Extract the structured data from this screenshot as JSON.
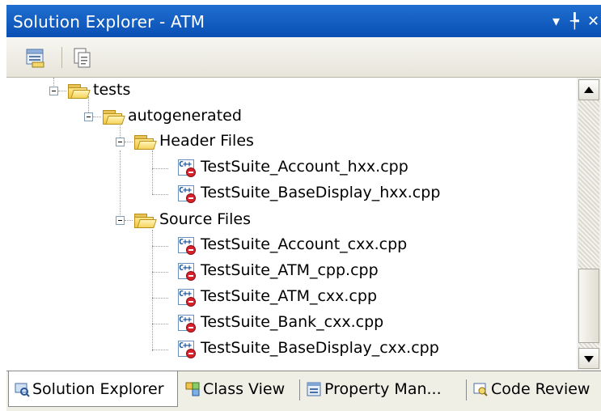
{
  "window": {
    "title": "Solution Explorer - ATM",
    "pin_glyph": "▾ ╄ ✕"
  },
  "toolbar": {
    "buttons": [
      {
        "icon": "properties-icon"
      },
      {
        "icon": "show-all-files-icon"
      }
    ]
  },
  "tree": {
    "items": [
      {
        "label": "tests",
        "type": "folder"
      },
      {
        "label": "autogenerated",
        "type": "folder"
      },
      {
        "label": "Header Files",
        "type": "folder"
      },
      {
        "label": "TestSuite_Account_hxx.cpp",
        "type": "cpp"
      },
      {
        "label": "TestSuite_BaseDisplay_hxx.cpp",
        "type": "cpp"
      },
      {
        "label": "Source Files",
        "type": "folder"
      },
      {
        "label": "TestSuite_Account_cxx.cpp",
        "type": "cpp"
      },
      {
        "label": "TestSuite_ATM_cpp.cpp",
        "type": "cpp"
      },
      {
        "label": "TestSuite_ATM_cxx.cpp",
        "type": "cpp"
      },
      {
        "label": "TestSuite_Bank_cxx.cpp",
        "type": "cpp"
      },
      {
        "label": "TestSuite_BaseDisplay_cxx.cpp",
        "type": "cpp"
      }
    ]
  },
  "tabs": [
    {
      "label": "Solution Explorer",
      "icon": "solution-explorer-icon",
      "active": true
    },
    {
      "label": "Class View",
      "icon": "class-view-icon",
      "active": false
    },
    {
      "label": "Property Man...",
      "icon": "property-manager-icon",
      "active": false
    },
    {
      "label": "Code Review",
      "icon": "code-review-icon",
      "active": false
    }
  ],
  "colors": {
    "title_bar": "#0a4fb3",
    "cpp_badge": "#d8202a"
  }
}
